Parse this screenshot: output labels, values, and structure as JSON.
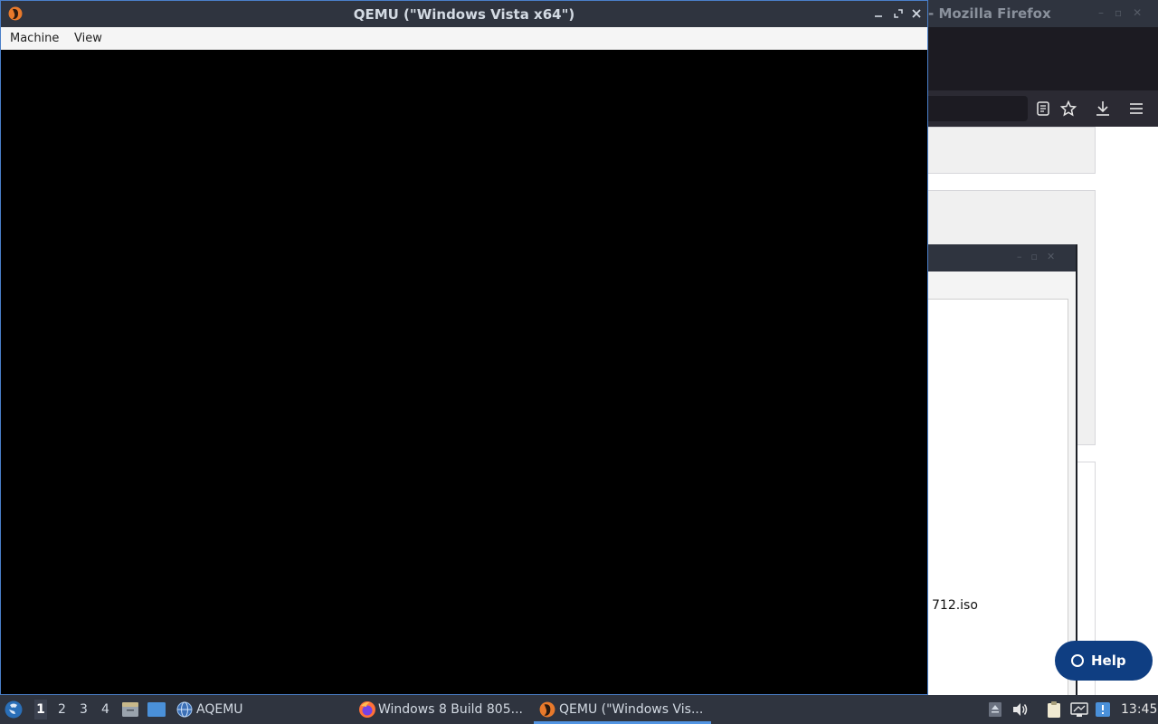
{
  "background_window": {
    "title": "- Mozilla Firefox",
    "dialog_file_fragment": "712.iso",
    "help_button_label": "Help"
  },
  "qemu": {
    "title": "QEMU (\"Windows Vista x64\")",
    "menu": [
      "Machine",
      "View"
    ]
  },
  "taskbar": {
    "workspaces": [
      "1",
      "2",
      "3",
      "4"
    ],
    "launchers": [
      {
        "icon": "file-manager-icon",
        "label": ""
      },
      {
        "icon": "desktop-icon",
        "label": ""
      },
      {
        "icon": "aqemu-icon",
        "label": "AQEMU"
      }
    ],
    "tasks": [
      {
        "icon": "firefox-icon",
        "label": "Windows 8 Build 805..."
      },
      {
        "icon": "qemu-icon",
        "label": "QEMU (\"Windows Vis..."
      }
    ],
    "clock": "13:45"
  },
  "colors": {
    "titlebar": "#2f343f",
    "accent": "#5294e2",
    "help_button": "#0f3e82"
  }
}
